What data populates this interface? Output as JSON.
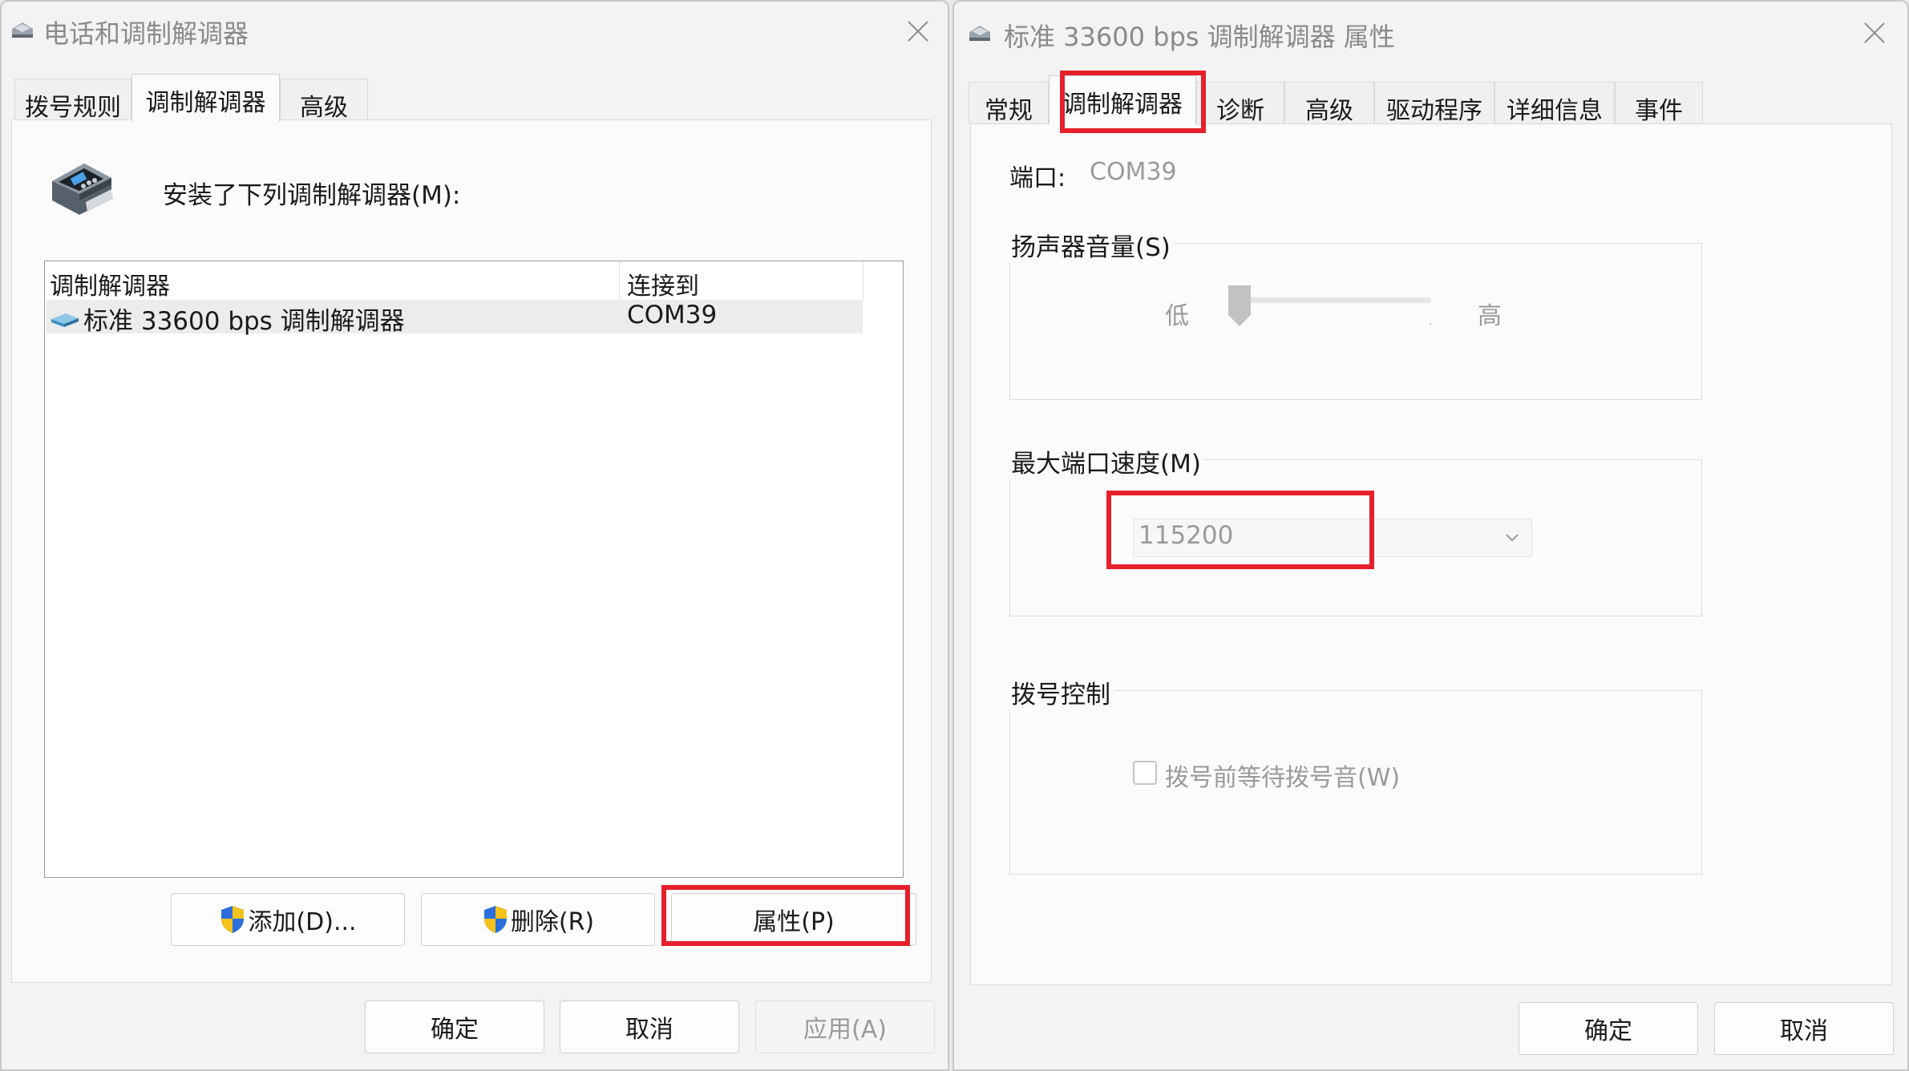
{
  "left_window": {
    "title": "电话和调制解调器",
    "tabs": [
      "拨号规则",
      "调制解调器",
      "高级"
    ],
    "installed_label": "安装了下列调制解调器(M):",
    "list": {
      "columns": [
        "调制解调器",
        "连接到"
      ],
      "rows": [
        {
          "modem": "标准 33600 bps 调制解调器",
          "port": "COM39"
        }
      ]
    },
    "buttons": {
      "add": "添加(D)...",
      "remove": "删除(R)",
      "properties": "属性(P)"
    },
    "footer": {
      "ok": "确定",
      "cancel": "取消",
      "apply": "应用(A)"
    }
  },
  "right_window": {
    "title": "标准 33600 bps 调制解调器 属性",
    "tabs": [
      "常规",
      "调制解调器",
      "诊断",
      "高级",
      "驱动程序",
      "详细信息",
      "事件"
    ],
    "port_label": "端口:",
    "port_value": "COM39",
    "speaker": {
      "group_label": "扬声器音量(S)",
      "low": "低",
      "high": "高"
    },
    "speed": {
      "group_label": "最大端口速度(M)",
      "value": "115200"
    },
    "dial": {
      "group_label": "拨号控制",
      "wait_tone": "拨号前等待拨号音(W)"
    },
    "footer": {
      "ok": "确定",
      "cancel": "取消"
    }
  },
  "colors": {
    "highlight": "#e5202b",
    "panel": "#fbfbfb",
    "window": "#f3f3f3"
  }
}
